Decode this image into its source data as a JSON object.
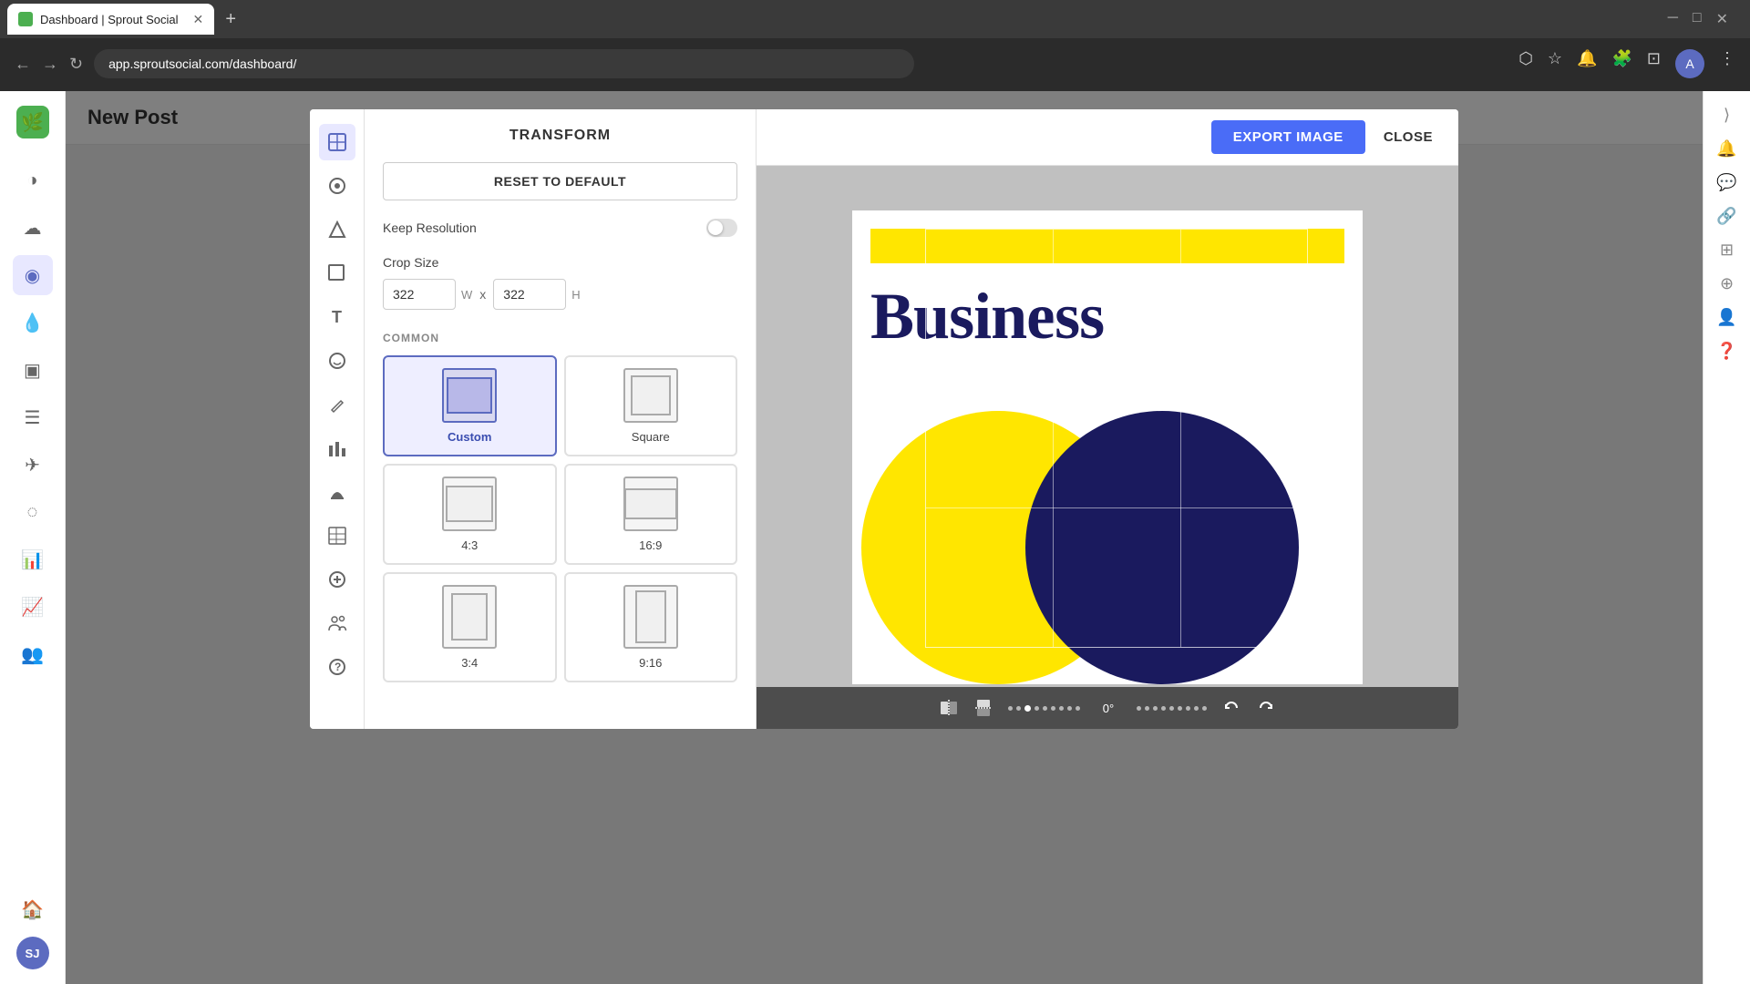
{
  "browser": {
    "tab_title": "Dashboard | Sprout Social",
    "favicon_color": "#4CAF50",
    "address": "app.sproutsocial.com/dashboard/",
    "new_tab_symbol": "+"
  },
  "toolbar": {
    "export_label": "EXPORT IMAGE",
    "close_label": "CLOSE"
  },
  "panel": {
    "title": "TRANSFORM",
    "reset_label": "RESET TO DEFAULT",
    "keep_resolution_label": "Keep Resolution",
    "crop_size_label": "Crop Size",
    "crop_width": "322",
    "crop_height": "322",
    "width_unit": "W",
    "height_unit": "H",
    "x_separator": "x",
    "section_common": "COMMON",
    "presets": [
      {
        "id": "custom",
        "label": "Custom",
        "active": true
      },
      {
        "id": "square",
        "label": "Square",
        "active": false
      },
      {
        "id": "4:3",
        "label": "4:3",
        "active": false
      },
      {
        "id": "16:9",
        "label": "16:9",
        "active": false
      },
      {
        "id": "3:4",
        "label": "3:4",
        "active": false
      },
      {
        "id": "9:16",
        "label": "9:16",
        "active": false
      }
    ]
  },
  "image": {
    "business_text": "Business",
    "rotation_value": "0°"
  },
  "sidebar": {
    "logo_icon": "🌿",
    "items": [
      {
        "icon": "◐",
        "label": "dashboard",
        "active": false
      },
      {
        "icon": "☁",
        "label": "publish",
        "active": false
      },
      {
        "icon": "◉",
        "label": "monitor",
        "active": true
      },
      {
        "icon": "💧",
        "label": "engage",
        "active": false
      },
      {
        "icon": "▣",
        "label": "reports",
        "active": false
      },
      {
        "icon": "☰",
        "label": "inbox",
        "active": false
      },
      {
        "icon": "✈",
        "label": "compose",
        "active": false
      },
      {
        "icon": "◌",
        "label": "filter",
        "active": false
      },
      {
        "icon": "📊",
        "label": "analytics",
        "active": false
      },
      {
        "icon": "📈",
        "label": "trends",
        "active": false
      },
      {
        "icon": "👥",
        "label": "audience",
        "active": false
      },
      {
        "icon": "🏠",
        "label": "home",
        "active": false
      }
    ],
    "user_initials": "SJ"
  },
  "page_title": "New Post"
}
